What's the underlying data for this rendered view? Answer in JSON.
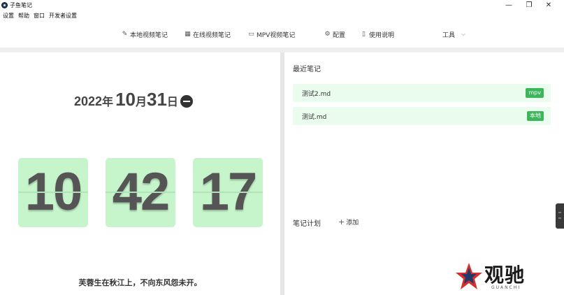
{
  "window": {
    "title": "子鱼笔记",
    "controls": {
      "minimize": "—",
      "maximize": "❐",
      "close": "✕"
    }
  },
  "menu": [
    "设置",
    "帮助",
    "窗口",
    "开发者设置"
  ],
  "toolbar": {
    "local_video": {
      "label": "本地视频笔记",
      "icon": "pen-icon"
    },
    "online_video": {
      "label": "在线视频笔记",
      "icon": "grid-icon"
    },
    "mpv_video": {
      "label": "MPV视频笔记",
      "icon": "monitor-icon"
    },
    "config": {
      "label": "配置",
      "icon": "gear-icon"
    },
    "manual": {
      "label": "使用说明",
      "icon": "document-icon"
    },
    "tools": {
      "label": "工具",
      "icon": "chevron-down-icon"
    }
  },
  "date": {
    "year": "2022",
    "year_unit": "年",
    "month": "10",
    "month_unit": "月",
    "day": "31",
    "day_unit": "日"
  },
  "clock": {
    "hours": "10",
    "minutes": "42",
    "seconds": "17"
  },
  "quote": "芙蓉生在秋江上，不向东风怨未开。",
  "recent_notes": {
    "title": "最近笔记",
    "items": [
      {
        "name": "测试2.md",
        "badge": "mpv"
      },
      {
        "name": "测试.md",
        "badge": "本地"
      }
    ]
  },
  "plan": {
    "title": "笔记计划",
    "add_label": "添加"
  },
  "watermark": {
    "text": "观驰",
    "sub": "GUANCHI"
  },
  "colors": {
    "accent_green": "#3cb55b",
    "flip_bg": "#c6f4cb",
    "note_bg": "#eafcee"
  }
}
